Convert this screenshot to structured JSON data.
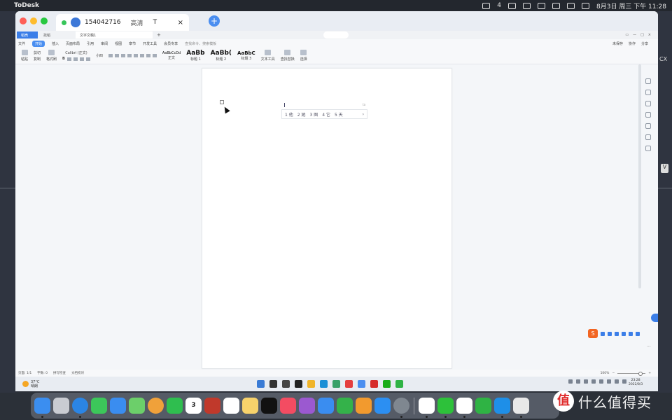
{
  "menubar": {
    "app_name": "ToDesk",
    "notification_count": "4",
    "datetime": "8月3日 周三 下午 11:28"
  },
  "todesk": {
    "device_id": "154042716",
    "quality": "高清",
    "tab_t": "T",
    "close": "×",
    "new_tab": "+"
  },
  "wps": {
    "tabs": {
      "home": "稻壳",
      "template": "找稻",
      "doc": "文字文稿1",
      "add": "+"
    },
    "menu": [
      "文件",
      "开始",
      "插入",
      "页面布局",
      "引用",
      "审阅",
      "视图",
      "章节",
      "开发工具",
      "会员专享"
    ],
    "active_menu": "开始",
    "search_hint": "查找命令、搜索模板",
    "menu_right": [
      "未保存",
      "协作",
      "分享"
    ],
    "ribbon": {
      "paste": "粘贴",
      "cut": "剪切",
      "copy": "复制",
      "format_painter": "格式刷",
      "font": "Calibri (正文)",
      "size": "小四",
      "styles": [
        {
          "preview": "AaBbCcDd",
          "label": "正文"
        },
        {
          "preview": "AaBb",
          "label": "标题 1"
        },
        {
          "preview": "AaBb(",
          "label": "标题 2"
        },
        {
          "preview": "AaBbC",
          "label": "标题 3"
        }
      ],
      "text_tools": "文本工具",
      "find_replace": "查找替换",
      "select": "选择"
    },
    "ime": {
      "candidates": [
        "1 他",
        "2 她",
        "3 图",
        "4 它",
        "5 天"
      ],
      "more": "›",
      "tag": "ta"
    },
    "statusbar": {
      "page": "页面: 1/1",
      "words": "字数: 0",
      "spellcheck": "拼写检查",
      "doc_check": "文档校对",
      "zoom": "100%"
    },
    "sogou": "S"
  },
  "taskbar": {
    "temperature": "37°C",
    "weather": "晴朗",
    "time": "23:28",
    "date": "2022/8/3"
  },
  "dock": {
    "calendar_day": "3",
    "apps": [
      "finder-icon",
      "launchpad-icon",
      "safari-icon",
      "messages-icon",
      "mail-icon",
      "maps-icon",
      "photos-icon",
      "facetime-icon",
      "calendar-icon",
      "app-icon",
      "reminders-icon",
      "notes-icon",
      "tv-icon",
      "music-icon",
      "podcasts-icon",
      "keynote-icon",
      "numbers-icon",
      "pages-icon",
      "appstore-icon",
      "settings-icon"
    ]
  },
  "watermark": {
    "logo": "值",
    "text": "什么值得买"
  },
  "side": {
    "label": "CX",
    "v": "V"
  },
  "colors": {
    "accent": "#3b7ee8",
    "todesk_blue": "#4a8ef0",
    "sogou": "#f26522"
  }
}
